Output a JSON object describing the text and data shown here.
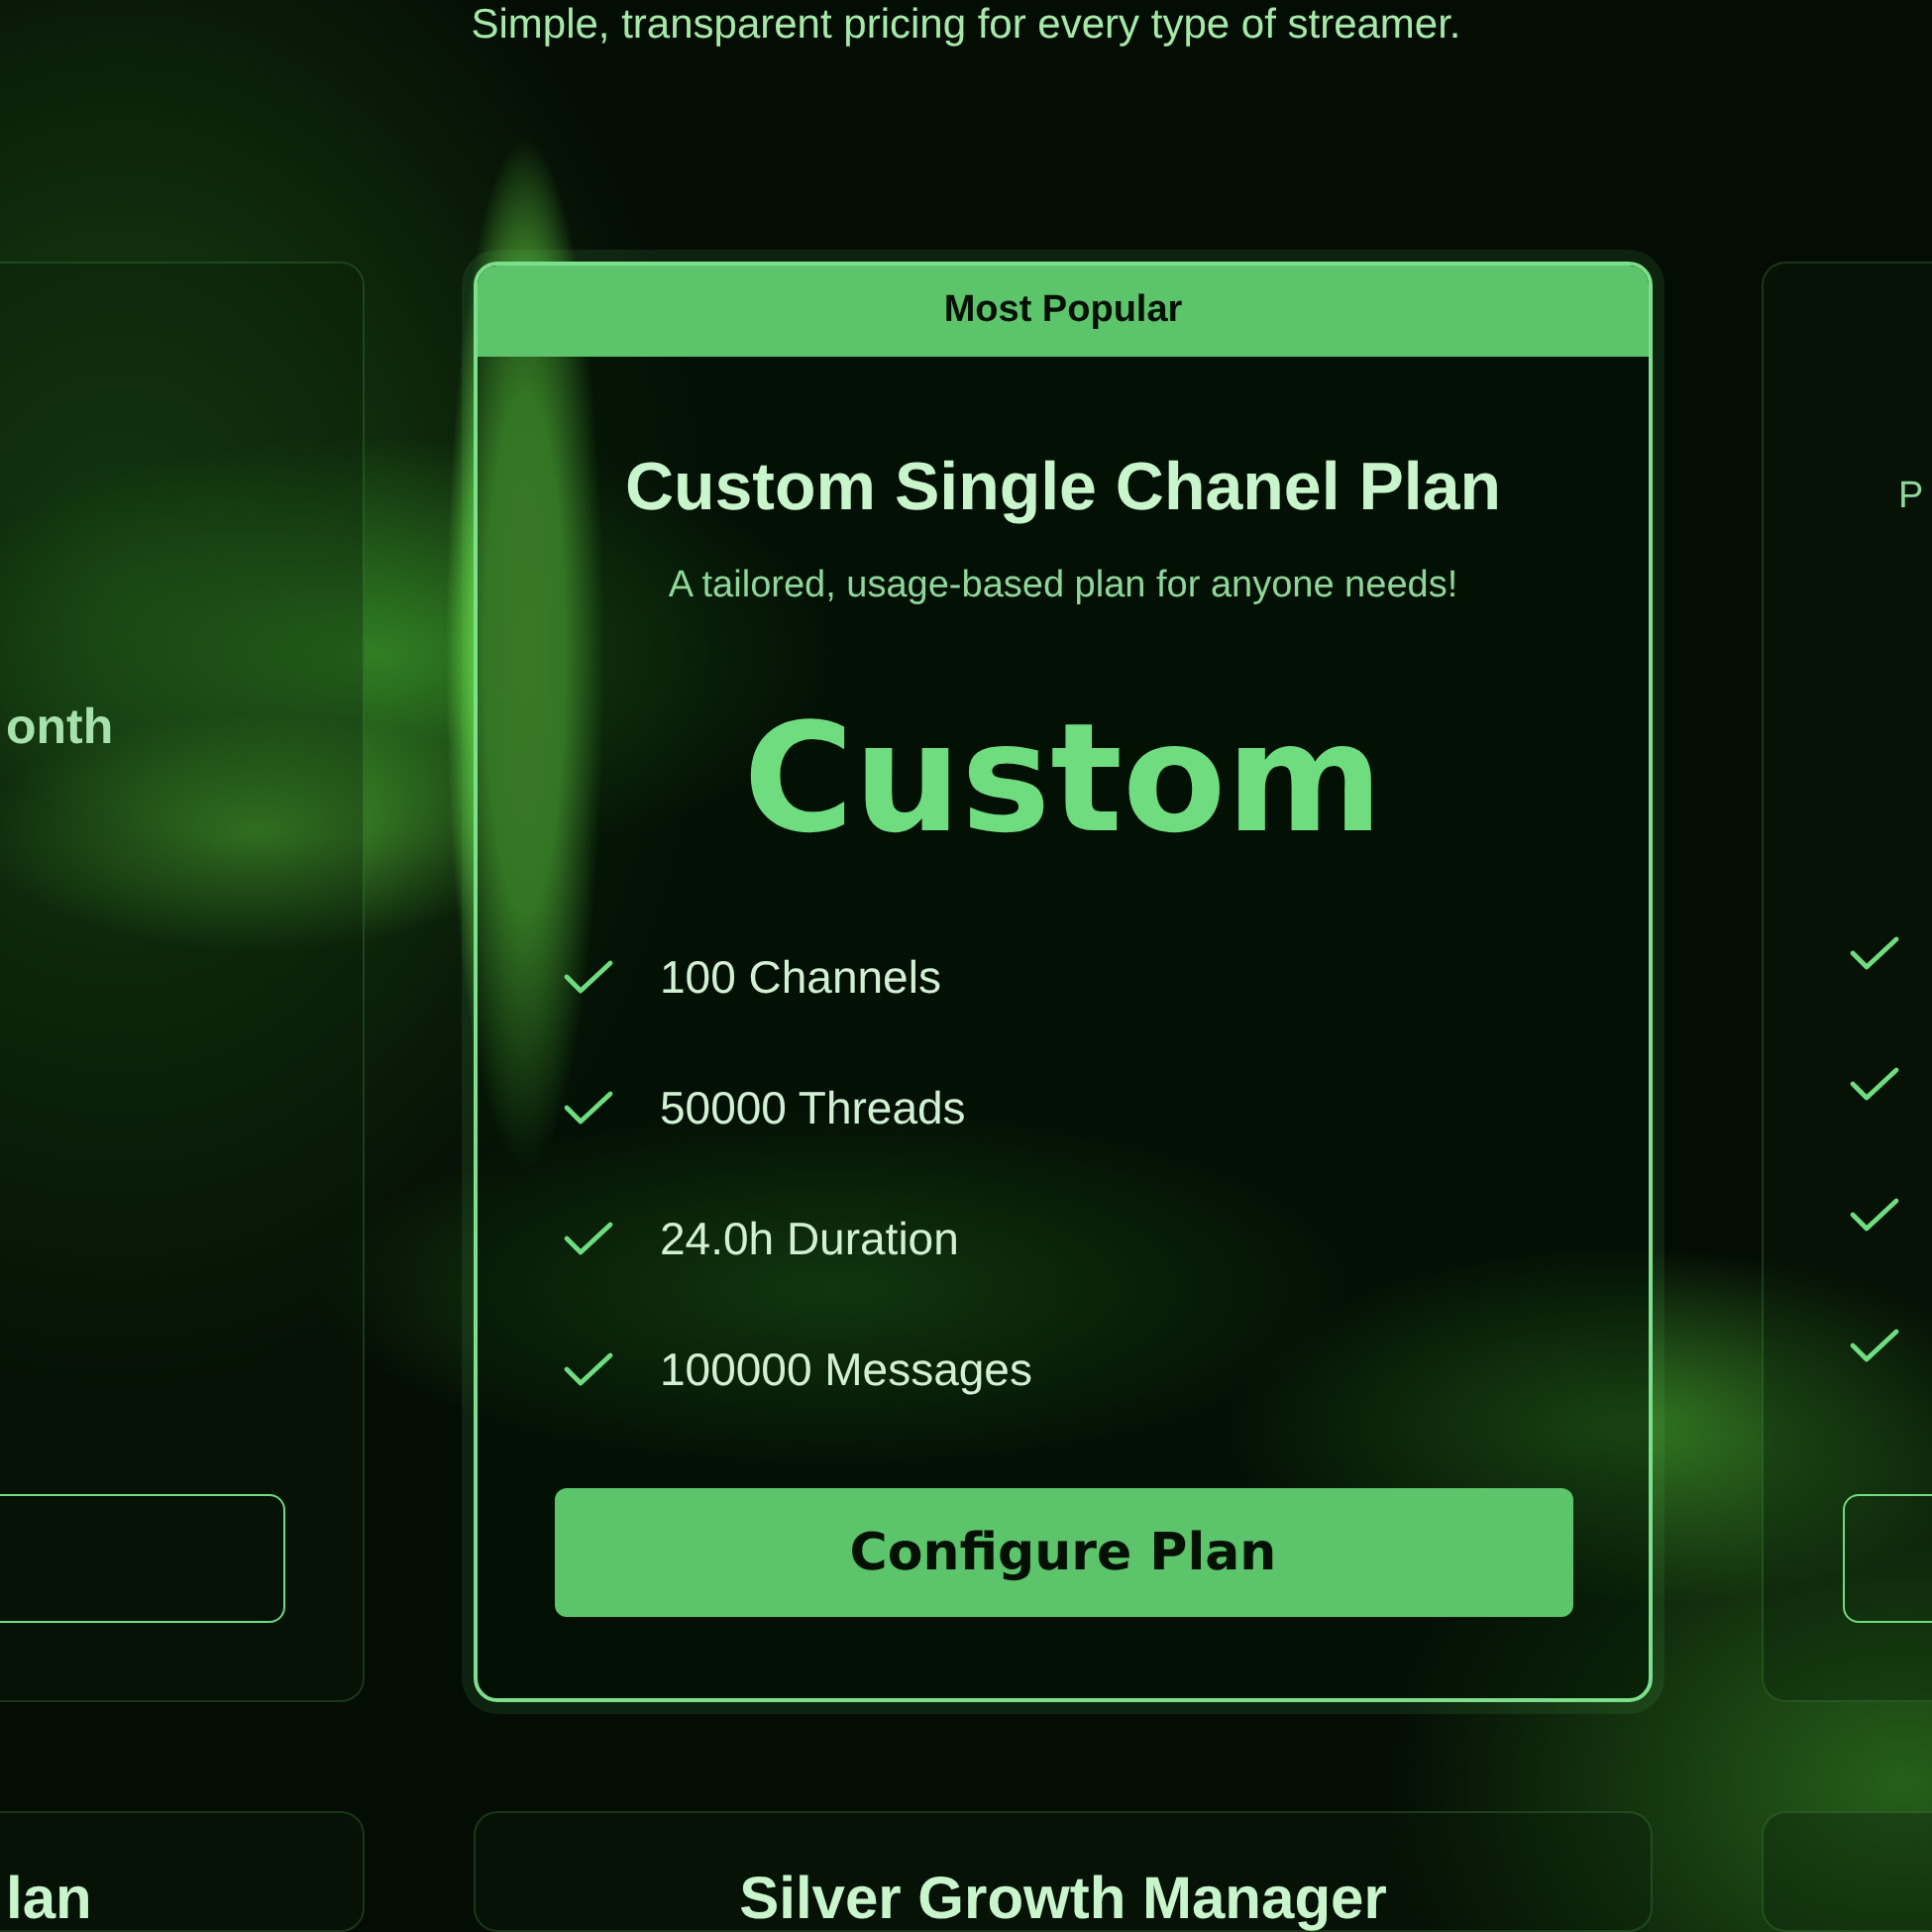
{
  "subtitle": "Simple, transparent pricing for every type of streamer.",
  "left_card": {
    "price_fragment": "onth"
  },
  "featured_card": {
    "badge": "Most Popular",
    "title": "Custom Single Chanel Plan",
    "description": "A tailored, usage-based plan for anyone needs!",
    "price": "Custom",
    "features": [
      "100 Channels",
      "50000 Threads",
      "24.0h Duration",
      "100000 Messages"
    ],
    "button": "Configure Plan"
  },
  "right_card": {
    "description_fragment": "P"
  },
  "bottom_cards": [
    {
      "title_fragment": "lan"
    },
    {
      "title": "Silver Growth Manager"
    }
  ]
}
